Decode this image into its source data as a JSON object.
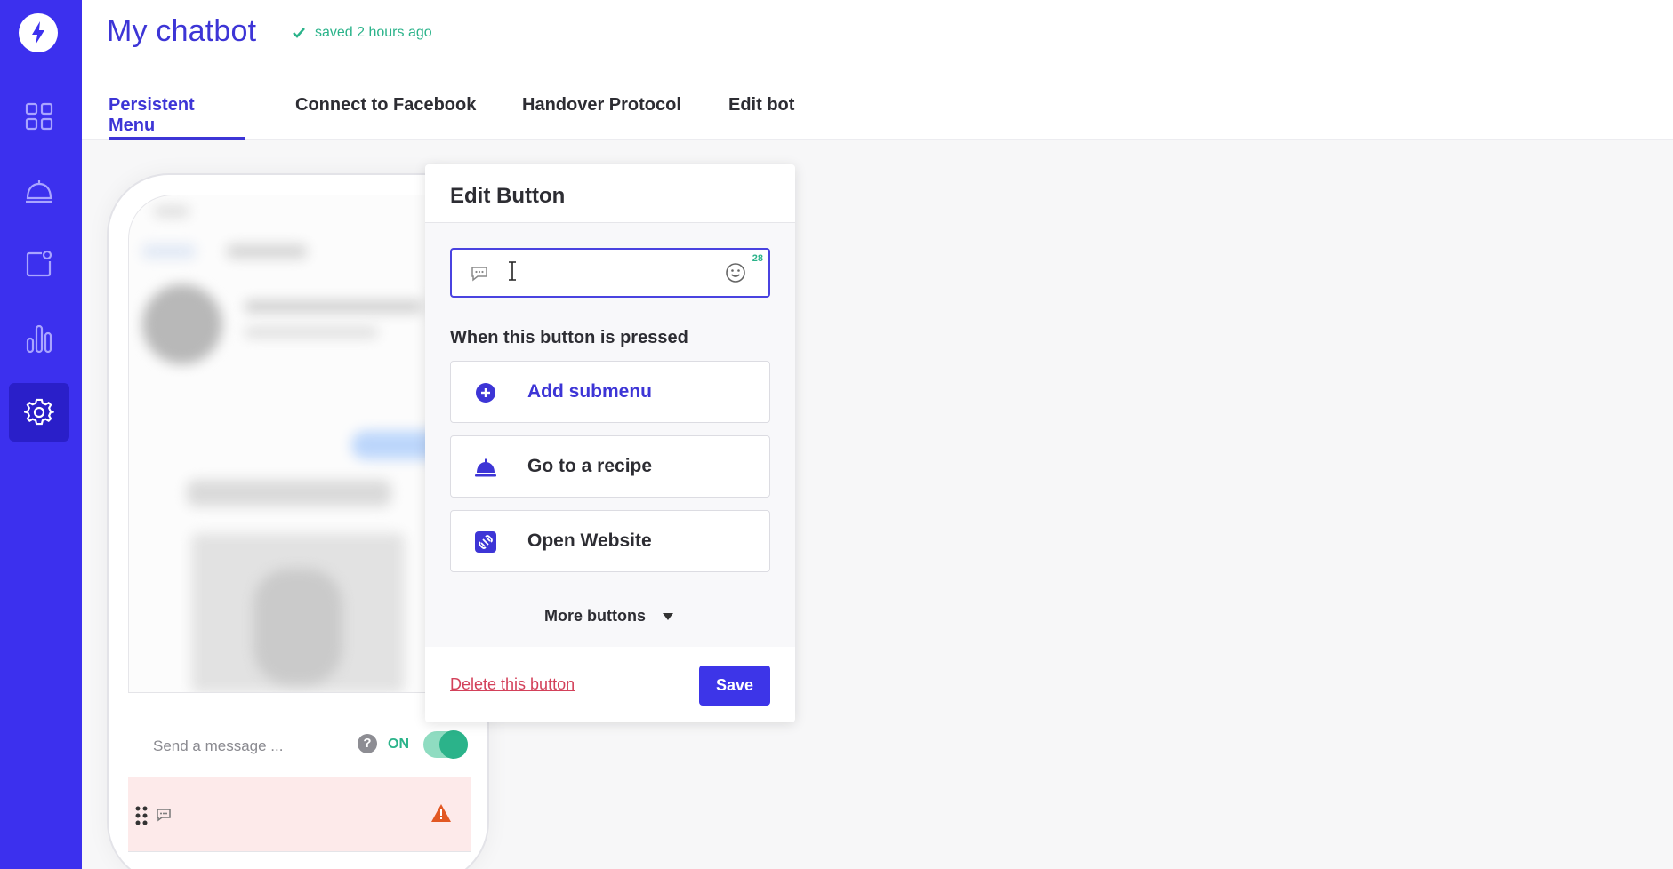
{
  "app": {
    "title": "My chatbot",
    "saved_status": "saved 2 hours ago"
  },
  "sidebar": {
    "items": [
      {
        "icon": "dashboard-icon",
        "active": false
      },
      {
        "icon": "recipe-bell-icon",
        "active": false
      },
      {
        "icon": "notification-icon",
        "active": false
      },
      {
        "icon": "stats-icon",
        "active": false
      },
      {
        "icon": "gear-icon",
        "active": true
      }
    ]
  },
  "tabs": [
    {
      "label": "Persistent Menu",
      "active": true
    },
    {
      "label": "Connect to Facebook",
      "active": false
    },
    {
      "label": "Handover Protocol",
      "active": false
    },
    {
      "label": "Edit bot",
      "active": false
    }
  ],
  "phone": {
    "composer_placeholder": "Send a message ...",
    "help_glyph": "?",
    "toggle_label": "ON"
  },
  "edit_popup": {
    "title": "Edit Button",
    "title_input_value": "",
    "char_count": "28",
    "pressed_label": "When this button is pressed",
    "actions": [
      {
        "label": "Add submenu",
        "icon": "plus-circle-icon"
      },
      {
        "label": "Go to a recipe",
        "icon": "recipe-bell-icon"
      },
      {
        "label": "Open Website",
        "icon": "link-icon"
      }
    ],
    "more_buttons": "More buttons",
    "delete_label": "Delete this button",
    "save_label": "Save"
  },
  "colors": {
    "brand": "#3c30ee",
    "accent_text": "#3d35d6",
    "success": "#2bb38a",
    "danger": "#d3415a"
  }
}
